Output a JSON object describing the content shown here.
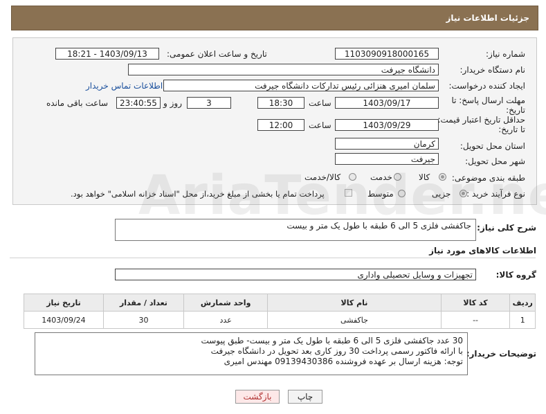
{
  "header": {
    "title": "جزئیات اطلاعات نیاز"
  },
  "fields": {
    "need_number_label": "شماره نیاز:",
    "need_number": "1103090918000165",
    "announce_label": "تاریخ و ساعت اعلان عمومی:",
    "announce_value": "1403/09/13 - 18:21",
    "buyer_org_label": "نام دستگاه خریدار:",
    "buyer_org": "دانشگاه جیرفت",
    "creator_label": "ایجاد کننده درخواست:",
    "creator": "سلمان امیری هنزائی رئیس تداركات دانشگاه جیرفت",
    "contact_link": "اطلاعات تماس خریدار",
    "reply_deadline_label": "مهلت ارسال پاسخ: تا تاریخ:",
    "reply_date": "1403/09/17",
    "time_label": "ساعت",
    "reply_time": "18:30",
    "days_count": "3",
    "day_and_label": "روز و",
    "remaining_time": "23:40:55",
    "remaining_label": "ساعت باقی مانده",
    "price_validity_label": "حداقل تاریخ اعتبار قیمت: تا تاریخ:",
    "price_date": "1403/09/29",
    "price_time": "12:00",
    "province_label": "استان محل تحویل:",
    "province": "کرمان",
    "city_label": "شهر محل تحویل:",
    "city": "جیرفت",
    "category_label": "طبقه بندی موضوعی:",
    "category_options": [
      "کالا",
      "خدمت",
      "کالا/خدمت"
    ],
    "process_label": "نوع فرآیند خرید :",
    "process_options": [
      "جزیی",
      "متوسط"
    ],
    "payment_note": "پرداخت تمام یا بخشی از مبلغ خرید،از محل \"اسناد خزانه اسلامی\" خواهد بود."
  },
  "summary": {
    "label": "شرح کلی نیاز:",
    "text": "جاکفشی فلزی 5 الی 6 طبقه با طول یک متر و بیست"
  },
  "goods_section_title": "اطلاعات کالاهای مورد نیاز",
  "goods_group": {
    "label": "گروه کالا:",
    "value": "تجهیزات و وسایل تحصیلی واداری"
  },
  "table": {
    "headers": [
      "ردیف",
      "کد کالا",
      "نام کالا",
      "واحد شمارش",
      "تعداد / مقدار",
      "تاریخ نیاز"
    ],
    "rows": [
      [
        "1",
        "--",
        "جاکفشی",
        "عدد",
        "30",
        "1403/09/24"
      ]
    ]
  },
  "buyer_notes": {
    "label": "توضیحات خریدار:",
    "lines": [
      "30 عدد جاکفشی فلزی 5 الی 6 طبقه با طول یک متر و بیست- طبق پیوست",
      "با ارائه فاکتور رسمی پرداخت 30 روز کاری بعد تحویل در دانشگاه جیرفت",
      "توجه:  هزینه ارسال بر عهده فروشنده 09139430386 مهندس امیری"
    ]
  },
  "buttons": {
    "print": "چاپ",
    "back": "بازگشت"
  },
  "watermark": "AriaTender.neT",
  "colors": {
    "header_bg": "#8a7152",
    "back_button_bg": "#fde8e8",
    "back_button_text": "#b03030"
  }
}
